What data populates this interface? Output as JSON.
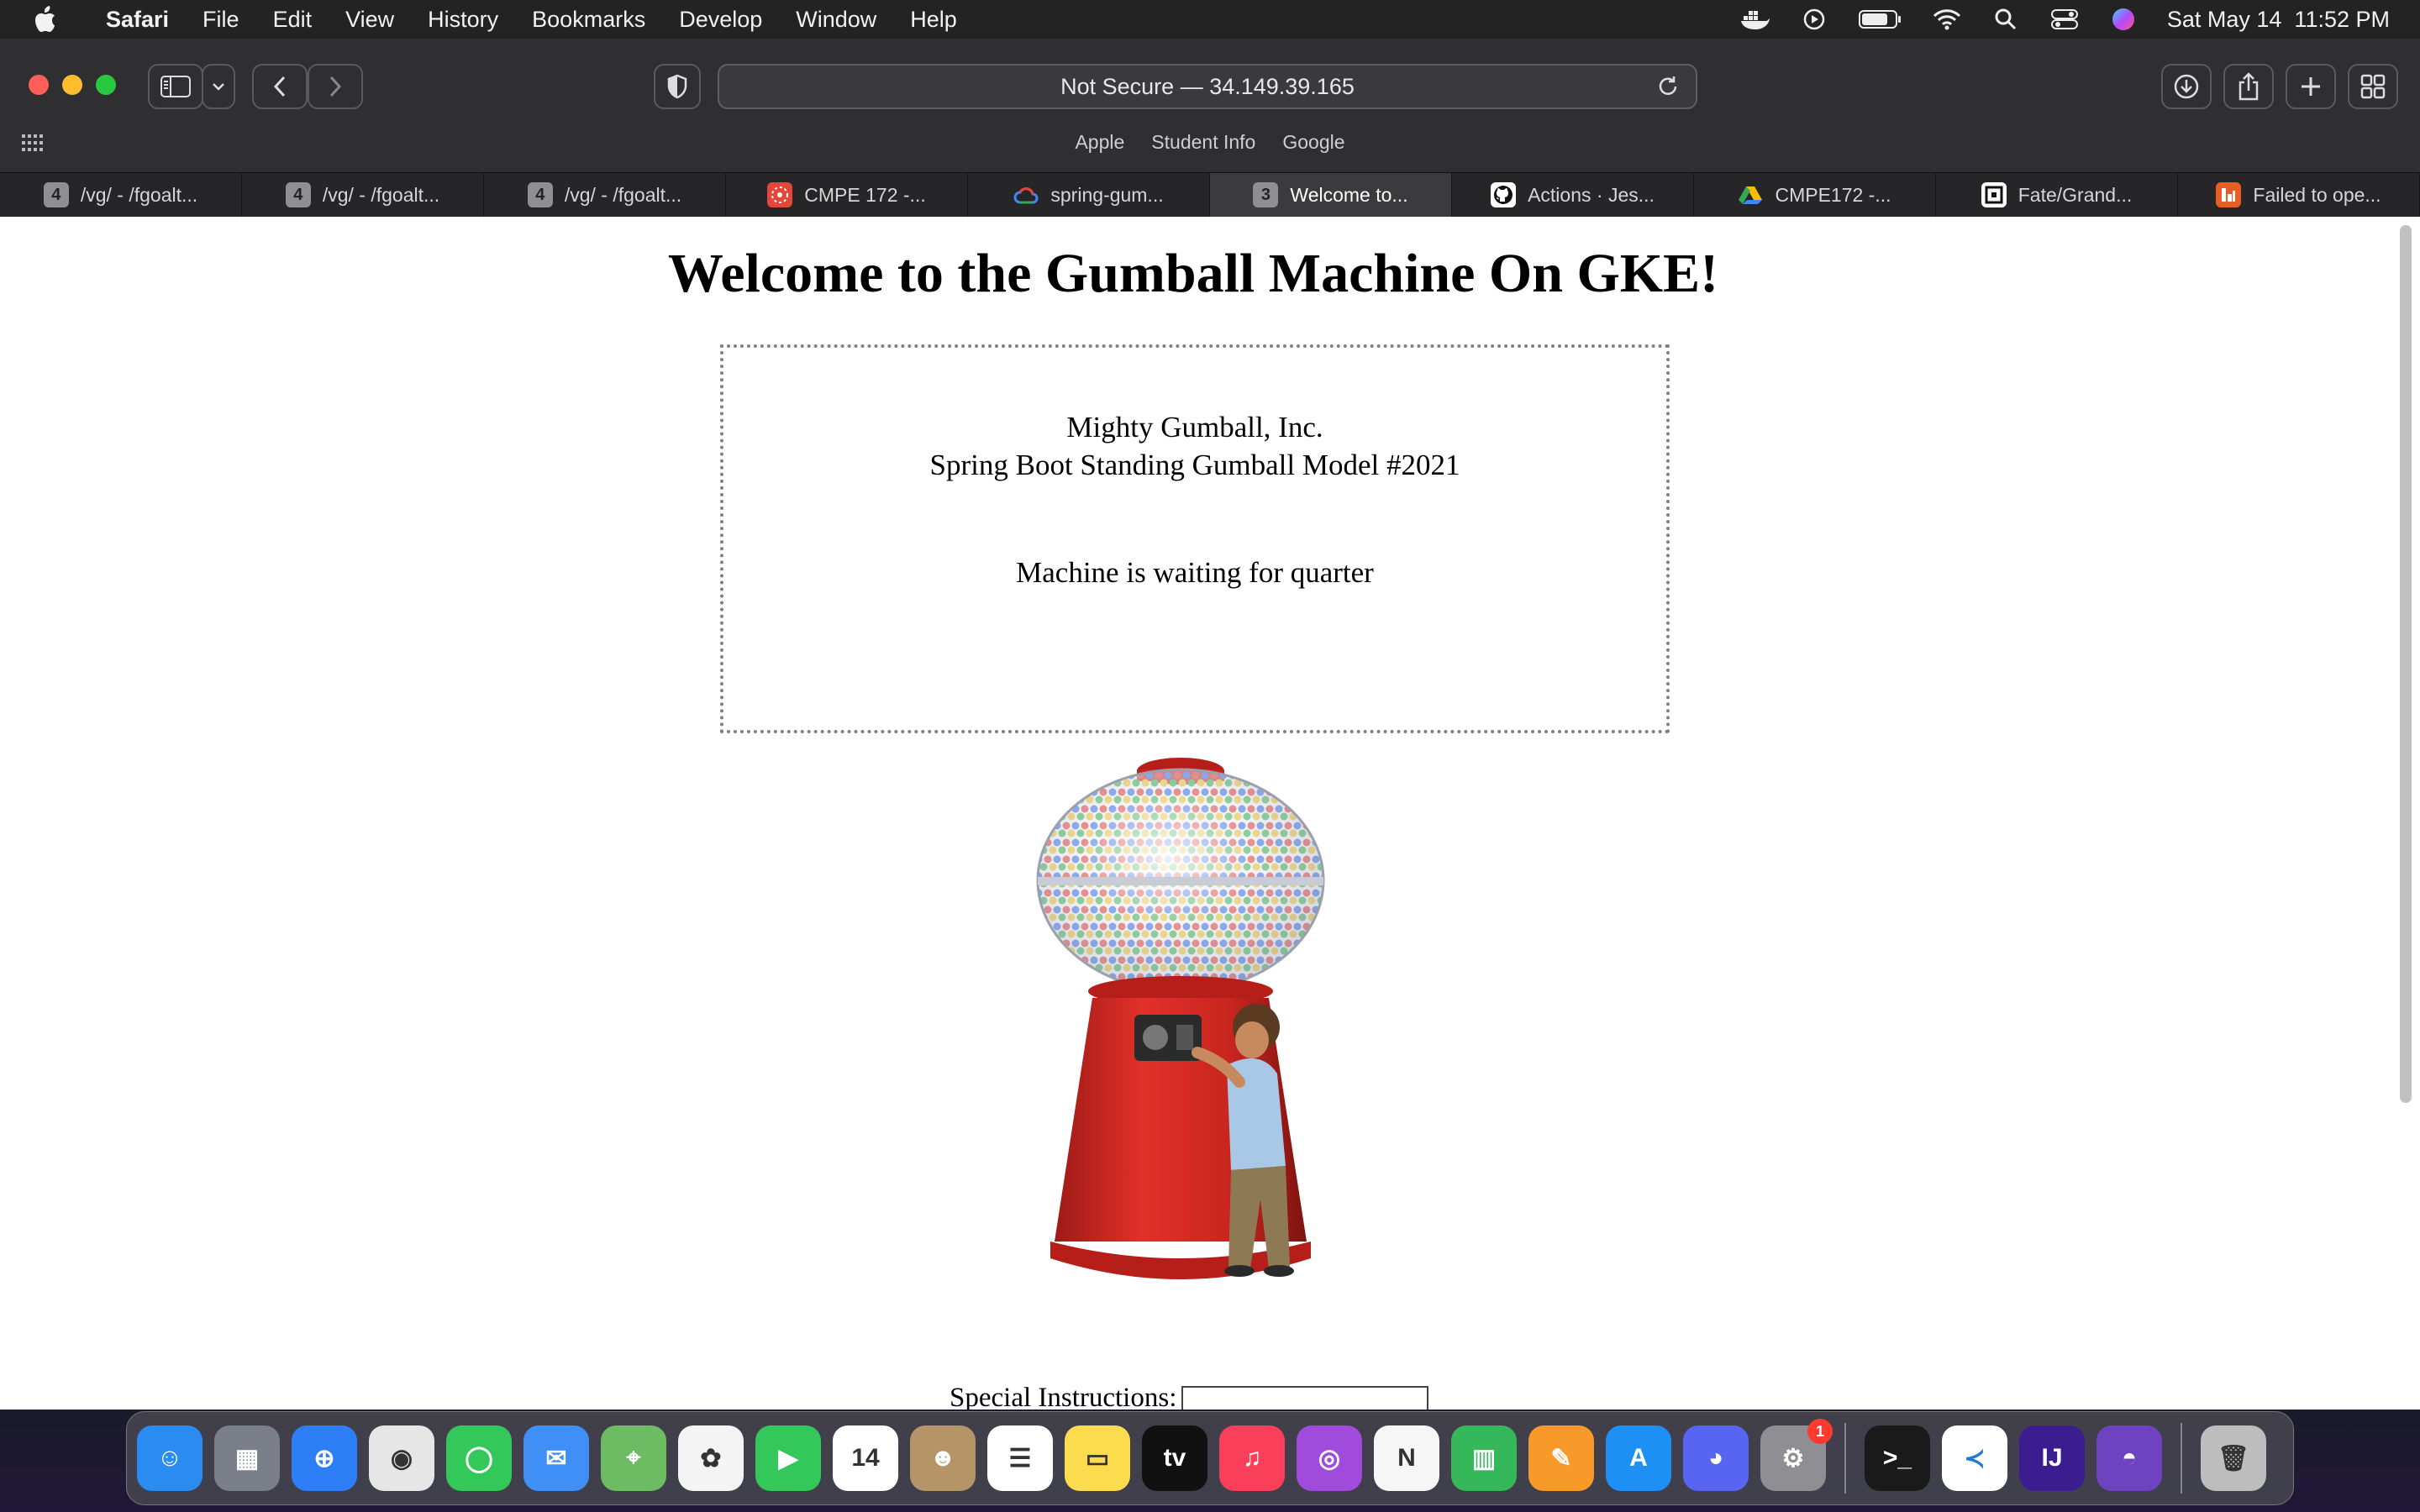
{
  "menubar": {
    "app_name": "Safari",
    "items": [
      "File",
      "Edit",
      "View",
      "History",
      "Bookmarks",
      "Develop",
      "Window",
      "Help"
    ],
    "clock": "Sat May 14  11:52 PM"
  },
  "toolbar": {
    "address": "Not Secure — 34.149.39.165",
    "favorites": [
      "Apple",
      "Student Info",
      "Google"
    ]
  },
  "tabs": [
    {
      "label": "/vg/ - /fgoalt...",
      "badge": "4",
      "icon": "badge-icon"
    },
    {
      "label": "/vg/ - /fgoalt...",
      "badge": "4",
      "icon": "badge-icon"
    },
    {
      "label": "/vg/ - /fgoalt...",
      "badge": "4",
      "icon": "badge-icon"
    },
    {
      "label": "CMPE 172 -...",
      "badge": "",
      "icon": "canvas-icon"
    },
    {
      "label": "spring-gum...",
      "badge": "",
      "icon": "google-cloud-icon"
    },
    {
      "label": "Welcome to...",
      "badge": "3",
      "icon": "badge-icon",
      "active": true
    },
    {
      "label": "Actions · Jes...",
      "badge": "",
      "icon": "github-icon"
    },
    {
      "label": "CMPE172 -...",
      "badge": "",
      "icon": "google-drive-icon"
    },
    {
      "label": "Fate/Grand...",
      "badge": "",
      "icon": "fandom-icon"
    },
    {
      "label": "Failed to ope...",
      "badge": "",
      "icon": "warning-icon"
    }
  ],
  "page": {
    "title": "Welcome to the Gumball Machine On GKE!",
    "company": "Mighty Gumball, Inc.",
    "model": "Spring Boot Standing Gumball Model #2021",
    "state": "Machine is waiting for quarter",
    "special_label": "Special Instructions:",
    "special_value": ""
  },
  "dock": {
    "apps": [
      {
        "name": "finder",
        "color": "#2a8cf0",
        "glyph": "☺"
      },
      {
        "name": "launchpad",
        "color": "#7a7f8a",
        "glyph": "▦"
      },
      {
        "name": "safari",
        "color": "#2d7ef7",
        "glyph": "⊕"
      },
      {
        "name": "chrome",
        "color": "#e6e6e6",
        "glyph": "◉"
      },
      {
        "name": "messages",
        "color": "#34c759",
        "glyph": "◯"
      },
      {
        "name": "mail",
        "color": "#3f8ff7",
        "glyph": "✉"
      },
      {
        "name": "maps",
        "color": "#6dbb63",
        "glyph": "⌖"
      },
      {
        "name": "photos",
        "color": "#f4f4f4",
        "glyph": "✿"
      },
      {
        "name": "facetime",
        "color": "#34c759",
        "glyph": "▶"
      },
      {
        "name": "calendar",
        "color": "#ffffff",
        "glyph": "14"
      },
      {
        "name": "contacts",
        "color": "#b59467",
        "glyph": "☻"
      },
      {
        "name": "reminders",
        "color": "#ffffff",
        "glyph": "☰"
      },
      {
        "name": "notes",
        "color": "#fddb4f",
        "glyph": "▭"
      },
      {
        "name": "tv",
        "color": "#111111",
        "glyph": "tv"
      },
      {
        "name": "music",
        "color": "#fa3f5a",
        "glyph": "♫"
      },
      {
        "name": "podcasts",
        "color": "#a04bdc",
        "glyph": "◎"
      },
      {
        "name": "news",
        "color": "#f6f6f6",
        "glyph": "N"
      },
      {
        "name": "numbers",
        "color": "#34b85a",
        "glyph": "▥"
      },
      {
        "name": "pages",
        "color": "#f79a2a",
        "glyph": "✎"
      },
      {
        "name": "app-store",
        "color": "#1d8ff5",
        "glyph": "A"
      },
      {
        "name": "discord",
        "color": "#5865f2",
        "glyph": "◕"
      },
      {
        "name": "system-preferences",
        "color": "#8e8e93",
        "glyph": "⚙",
        "badge": "1"
      },
      {
        "name": "terminal",
        "color": "#1a1a1a",
        "glyph": ">_"
      },
      {
        "name": "vscode",
        "color": "#ffffff",
        "glyph": "≺"
      },
      {
        "name": "intellij",
        "color": "#3b1d8f",
        "glyph": "IJ"
      },
      {
        "name": "github-desktop",
        "color": "#6f42c1",
        "glyph": "◓"
      },
      {
        "name": "trash",
        "color": "#bdbdbd",
        "glyph": "🗑"
      }
    ]
  }
}
